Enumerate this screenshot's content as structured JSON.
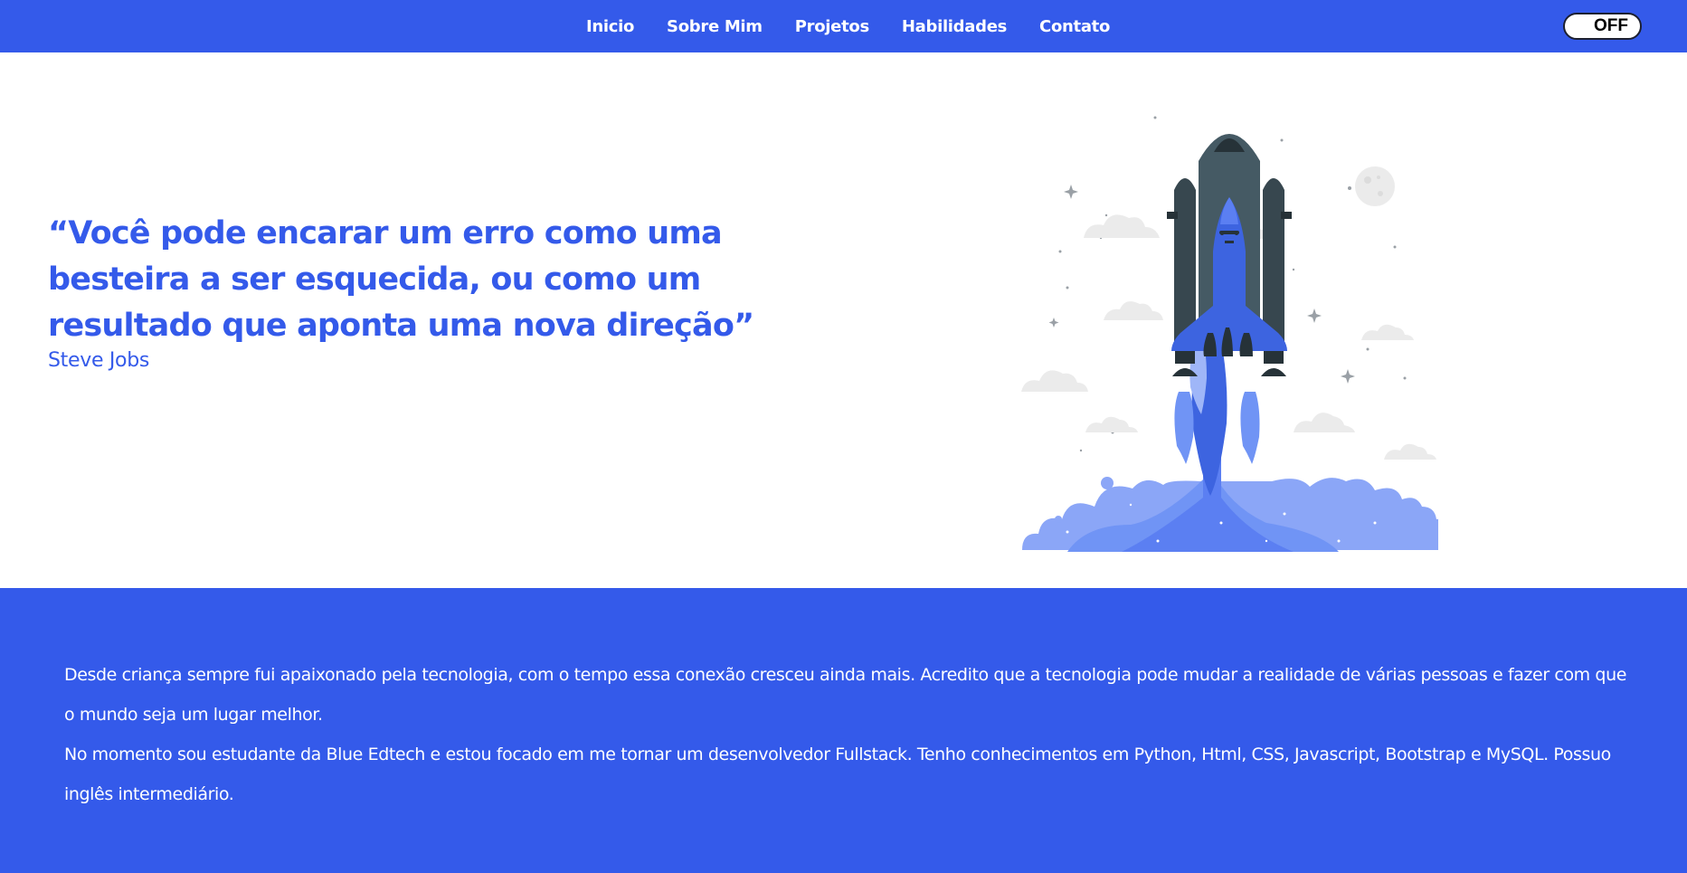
{
  "nav": {
    "links": [
      "Inicio",
      "Sobre Mim",
      "Projetos",
      "Habilidades",
      "Contato"
    ],
    "toggle_label": "OFF"
  },
  "hero": {
    "quote": "“Você pode encarar um erro como uma besteira a ser esquecida, ou como um resultado que aponta uma nova direção”",
    "author": "Steve Jobs"
  },
  "about": {
    "paragraphs": [
      "Desde criança sempre fui apaixonado pela tecnologia, com o tempo essa conexão cresceu ainda mais. Acredito que a tecnologia pode mudar a realidade de várias pessoas e fazer com que o mundo seja um lugar melhor.",
      "No momento sou estudante da Blue Edtech e estou focado em me tornar um desenvolvedor Fullstack. Tenho conhecimentos em Python, Html, CSS, Javascript, Bootstrap e MySQL. Possuo inglês intermediário."
    ]
  },
  "colors": {
    "primary": "#345aea",
    "rocket_body": "#3d64e0",
    "rocket_dark": "#37474f",
    "smoke": "#7fa0f5",
    "cloud": "#e6e6e6"
  },
  "icons": {
    "illustration": "rocket-launch-illustration"
  }
}
